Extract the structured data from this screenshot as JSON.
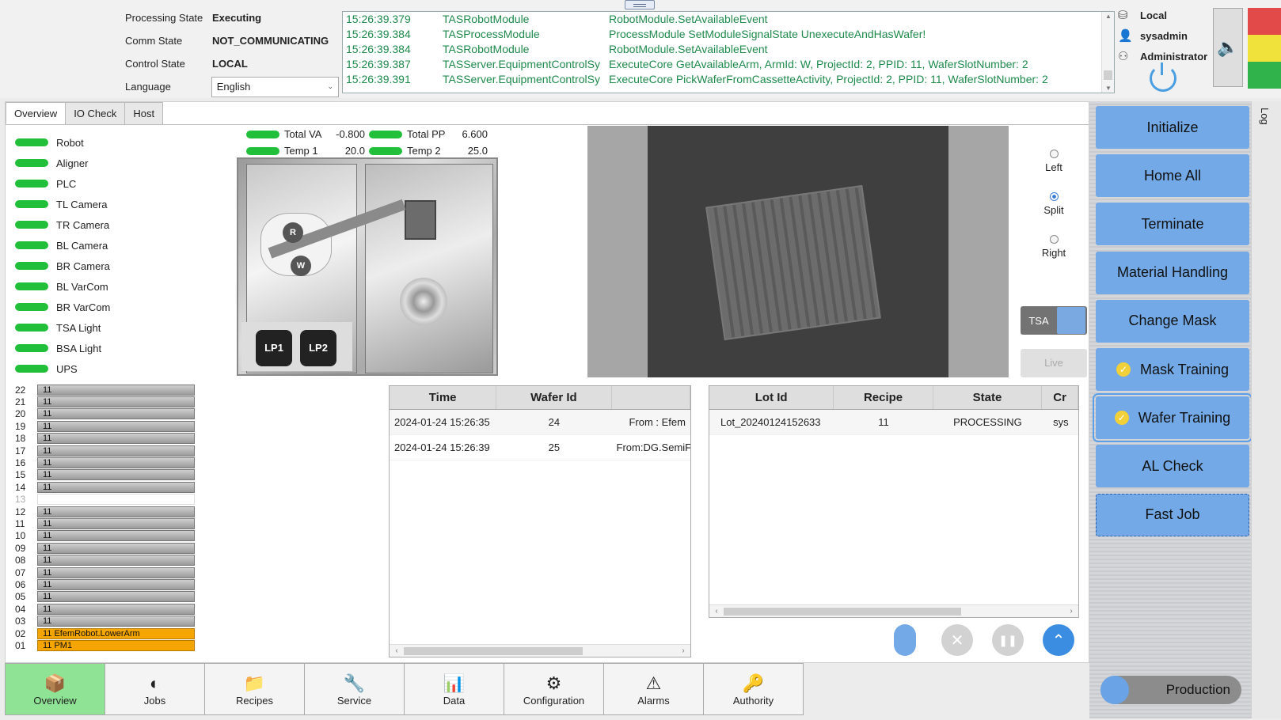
{
  "header": {
    "states": [
      {
        "label": "Processing State",
        "value": "Executing"
      },
      {
        "label": "Comm State",
        "value": "NOT_COMMUNICATING"
      },
      {
        "label": "Control State",
        "value": "LOCAL"
      }
    ],
    "language_label": "Language",
    "language_value": "English",
    "log": [
      {
        "time": "15:26:39.379",
        "module": "TASRobotModule",
        "message": "RobotModule.SetAvailableEvent"
      },
      {
        "time": "15:26:39.384",
        "module": "TASProcessModule",
        "message": "ProcessModule SetModuleSignalState UnexecuteAndHasWafer!"
      },
      {
        "time": "15:26:39.384",
        "module": "TASRobotModule",
        "message": "RobotModule.SetAvailableEvent"
      },
      {
        "time": "15:26:39.387",
        "module": "TASServer.EquipmentControlSy",
        "message": "ExecuteCore GetAvailableArm, ArmId: W, ProjectId: 2, PPID: 11, WaferSlotNumber: 2"
      },
      {
        "time": "15:26:39.391",
        "module": "TASServer.EquipmentControlSy",
        "message": "ExecuteCore PickWaferFromCassetteActivity, ProjectId: 2, PPID: 11, WaferSlotNumber: 2"
      }
    ],
    "user": {
      "location": "Local",
      "username": "sysadmin",
      "role": "Administrator"
    },
    "tower_colors": [
      "#e24a4a",
      "#f0e23a",
      "#2fb34a"
    ]
  },
  "tabs": [
    "Overview",
    "IO Check",
    "Host"
  ],
  "status_items": [
    "Robot",
    "Aligner",
    "PLC",
    "TL Camera",
    "TR Camera",
    "BL Camera",
    "BR Camera",
    "BL VarCom",
    "BR VarCom",
    "TSA Light",
    "BSA Light",
    "UPS"
  ],
  "gauges": [
    {
      "name": "Total VA",
      "value": "-0.800"
    },
    {
      "name": "Total PP",
      "value": "6.600"
    },
    {
      "name": "Temp 1",
      "value": "20.0"
    },
    {
      "name": "Temp 2",
      "value": "25.0"
    }
  ],
  "equipment": {
    "robot_arms": [
      "R",
      "W"
    ],
    "load_ports": [
      "LP1",
      "LP2"
    ]
  },
  "view_modes": [
    {
      "label": "Left",
      "checked": false
    },
    {
      "label": "Split",
      "checked": true
    },
    {
      "label": "Right",
      "checked": false
    }
  ],
  "tsa_label": "TSA",
  "live_label": "Live",
  "slots": [
    {
      "num": "22",
      "text": "11",
      "state": "filled"
    },
    {
      "num": "21",
      "text": "11",
      "state": "filled"
    },
    {
      "num": "20",
      "text": "11",
      "state": "filled"
    },
    {
      "num": "19",
      "text": "11",
      "state": "filled"
    },
    {
      "num": "18",
      "text": "11",
      "state": "filled"
    },
    {
      "num": "17",
      "text": "11",
      "state": "filled"
    },
    {
      "num": "16",
      "text": "11",
      "state": "filled"
    },
    {
      "num": "15",
      "text": "11",
      "state": "filled"
    },
    {
      "num": "14",
      "text": "11",
      "state": "filled"
    },
    {
      "num": "13",
      "text": "",
      "state": "empty"
    },
    {
      "num": "12",
      "text": "11",
      "state": "filled"
    },
    {
      "num": "11",
      "text": "11",
      "state": "filled"
    },
    {
      "num": "10",
      "text": "11",
      "state": "filled"
    },
    {
      "num": "09",
      "text": "11",
      "state": "filled"
    },
    {
      "num": "08",
      "text": "11",
      "state": "filled"
    },
    {
      "num": "07",
      "text": "11",
      "state": "filled"
    },
    {
      "num": "06",
      "text": "11",
      "state": "filled"
    },
    {
      "num": "05",
      "text": "11",
      "state": "filled"
    },
    {
      "num": "04",
      "text": "11",
      "state": "filled"
    },
    {
      "num": "03",
      "text": "11",
      "state": "filled"
    },
    {
      "num": "02",
      "text": "11 EfemRobot.LowerArm",
      "state": "active"
    },
    {
      "num": "01",
      "text": "11 PM1",
      "state": "active"
    }
  ],
  "wafer_table": {
    "columns": [
      "Time",
      "Wafer Id",
      ""
    ],
    "rows": [
      [
        "2024-01-24 15:26:35",
        "24",
        "From : Efem"
      ],
      [
        "2024-01-24 15:26:39",
        "25",
        "From:DG.SemiFra"
      ]
    ]
  },
  "lot_table": {
    "columns": [
      "Lot Id",
      "Recipe",
      "State",
      "Cr"
    ],
    "rows": [
      [
        "Lot_20240124152633",
        "11",
        "PROCESSING",
        "sys"
      ]
    ]
  },
  "actions": [
    {
      "label": "Initialize",
      "checked": false
    },
    {
      "label": "Home All",
      "checked": false
    },
    {
      "label": "Terminate",
      "checked": false
    },
    {
      "label": "Material Handling",
      "checked": false
    },
    {
      "label": "Change Mask",
      "checked": false
    },
    {
      "label": "Mask Training",
      "checked": true
    },
    {
      "label": "Wafer Training",
      "checked": true
    },
    {
      "label": "AL Check",
      "checked": false
    },
    {
      "label": "Fast Job",
      "checked": false
    }
  ],
  "side_tab": "Log",
  "nav": [
    {
      "label": "Overview",
      "icon": "📦"
    },
    {
      "label": "Jobs",
      "icon": "◐"
    },
    {
      "label": "Recipes",
      "icon": "📁"
    },
    {
      "label": "Service",
      "icon": "🔧"
    },
    {
      "label": "Data",
      "icon": "📊"
    },
    {
      "label": "Configuration",
      "icon": "⚙"
    },
    {
      "label": "Alarms",
      "icon": "⚠"
    },
    {
      "label": "Authority",
      "icon": "🔑"
    }
  ],
  "mode_label": "Production"
}
